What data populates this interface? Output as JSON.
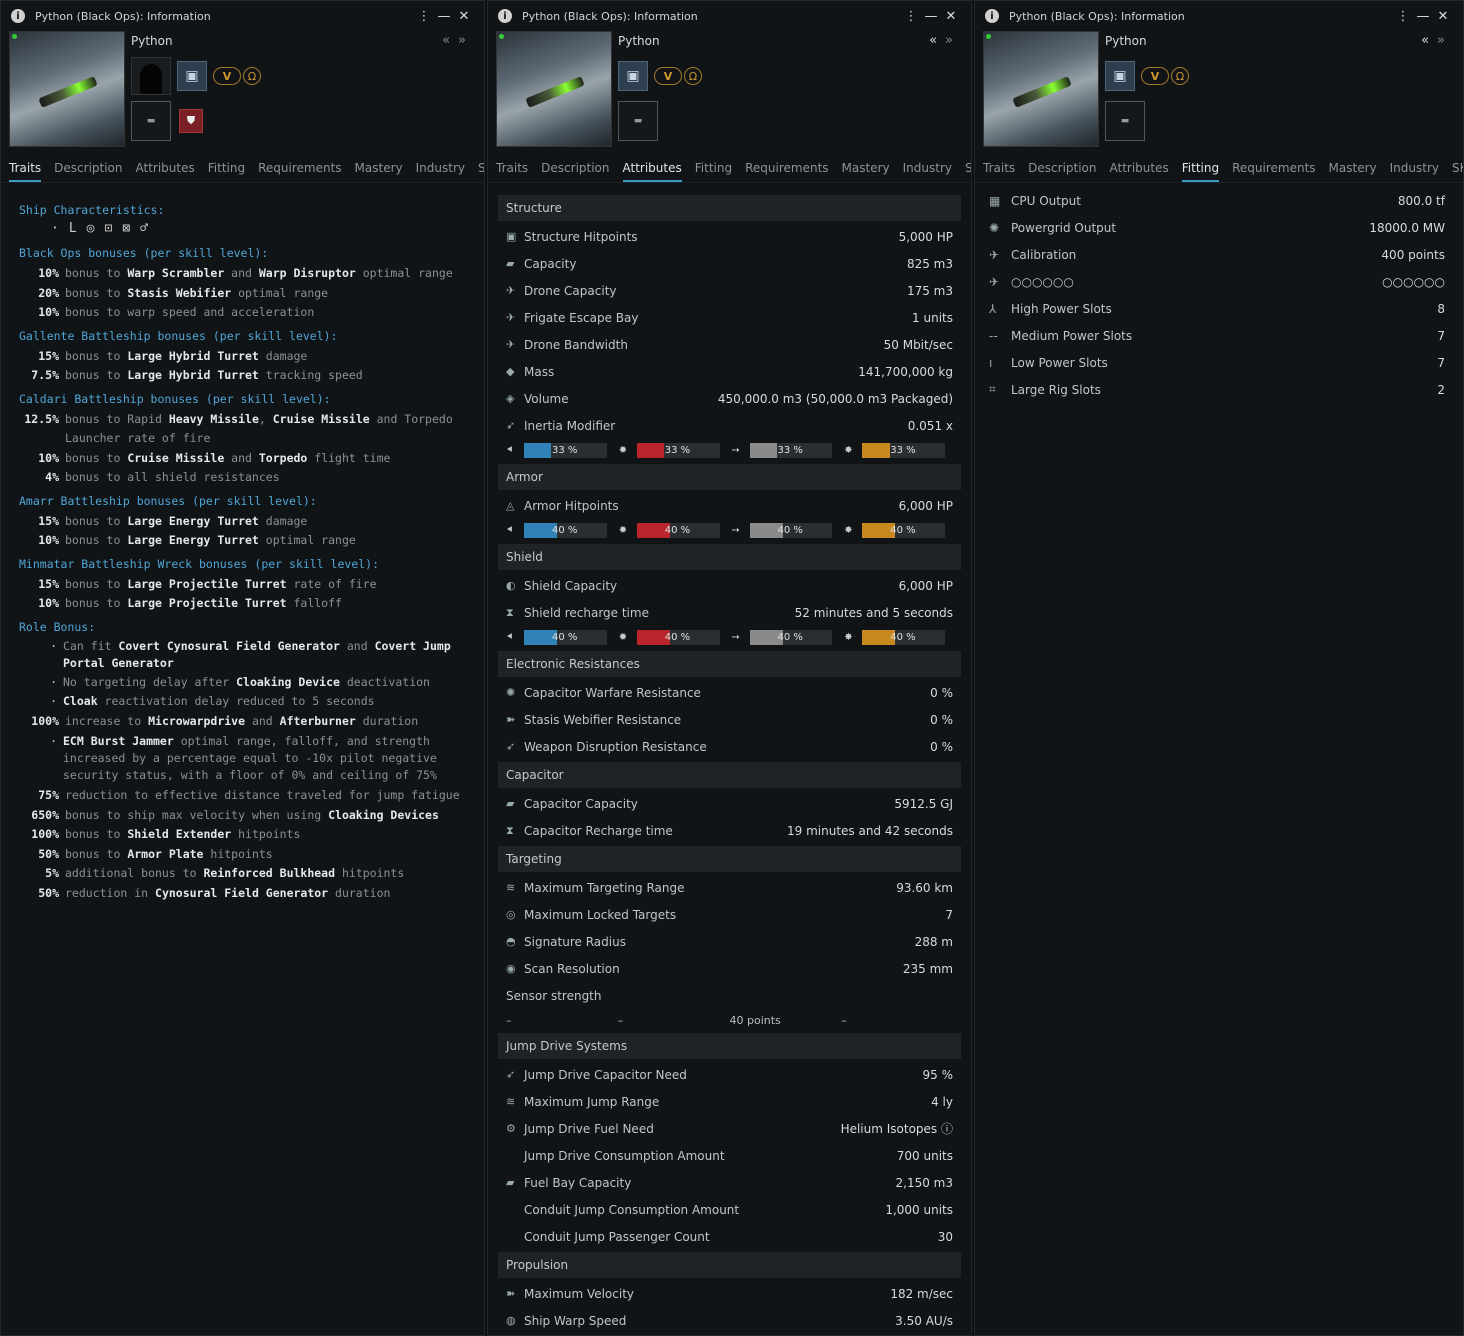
{
  "window_title": "Python (Black Ops): Information",
  "ship_name": "Python",
  "tabs": [
    "Traits",
    "Description",
    "Attributes",
    "Fitting",
    "Requirements",
    "Mastery",
    "Industry",
    "SKINs"
  ],
  "traits": {
    "ship_chars": "Ship Characteristics:",
    "black_ops": {
      "title": "Black Ops bonuses (per skill level):",
      "rows": [
        {
          "pct": "10%",
          "pre": "bonus to ",
          "b1": "Warp Scrambler",
          "m1": " and ",
          "b2": "Warp Disruptor",
          "post": " optimal range"
        },
        {
          "pct": "20%",
          "pre": "bonus to ",
          "b1": "Stasis Webifier",
          "m1": "",
          "b2": "",
          "post": " optimal range"
        },
        {
          "pct": "10%",
          "pre": "bonus to warp speed and acceleration",
          "b1": "",
          "m1": "",
          "b2": "",
          "post": ""
        }
      ]
    },
    "gallente": {
      "title": "Gallente Battleship bonuses (per skill level):",
      "rows": [
        {
          "pct": "15%",
          "pre": "bonus to ",
          "b1": "Large Hybrid Turret",
          "m1": "",
          "b2": "",
          "post": " damage"
        },
        {
          "pct": "7.5%",
          "pre": "bonus to ",
          "b1": "Large Hybrid Turret",
          "m1": "",
          "b2": "",
          "post": " tracking speed"
        }
      ]
    },
    "caldari": {
      "title": "Caldari Battleship bonuses (per skill level):",
      "rows": [
        {
          "pct": "12.5%",
          "pre": "bonus to Rapid ",
          "b1": "Heavy Missile",
          "m1": ", ",
          "b2": "Cruise Missile",
          "post": " and Torpedo Launcher rate of fire"
        },
        {
          "pct": "10%",
          "pre": "bonus to ",
          "b1": "Cruise Missile",
          "m1": " and ",
          "b2": "Torpedo",
          "post": " flight time"
        },
        {
          "pct": "4%",
          "pre": "bonus to all shield resistances",
          "b1": "",
          "m1": "",
          "b2": "",
          "post": ""
        }
      ]
    },
    "amarr": {
      "title": "Amarr Battleship bonuses (per skill level):",
      "rows": [
        {
          "pct": "15%",
          "pre": "bonus to ",
          "b1": "Large Energy Turret",
          "m1": "",
          "b2": "",
          "post": " damage"
        },
        {
          "pct": "10%",
          "pre": "bonus to ",
          "b1": "Large Energy Turret",
          "m1": "",
          "b2": "",
          "post": " optimal range"
        }
      ]
    },
    "minmatar": {
      "title": "Minmatar Battleship Wreck bonuses (per skill level):",
      "rows": [
        {
          "pct": "15%",
          "pre": "bonus to ",
          "b1": "Large Projectile Turret",
          "m1": "",
          "b2": "",
          "post": " rate of fire"
        },
        {
          "pct": "10%",
          "pre": "bonus to ",
          "b1": "Large Projectile Turret",
          "m1": "",
          "b2": "",
          "post": " falloff"
        }
      ]
    },
    "role": {
      "title": "Role Bonus:",
      "rows": [
        {
          "pct": "·",
          "pre": "Can fit ",
          "b1": "Covert Cynosural Field Generator",
          "m1": " and ",
          "b2": "Covert Jump Portal Generator",
          "post": ""
        },
        {
          "pct": "·",
          "pre": "No targeting delay after ",
          "b1": "Cloaking Device",
          "m1": "",
          "b2": "",
          "post": " deactivation"
        },
        {
          "pct": "·",
          "pre": "",
          "b1": "Cloak",
          "m1": "",
          "b2": "",
          "post": " reactivation delay reduced to 5 seconds"
        },
        {
          "pct": "100%",
          "pre": "increase to ",
          "b1": "Microwarpdrive",
          "m1": " and ",
          "b2": "Afterburner",
          "post": " duration"
        },
        {
          "pct": "·",
          "pre": "",
          "b1": "ECM Burst Jammer",
          "m1": "",
          "b2": "",
          "post": " optimal range, falloff, and strength increased by a percentage equal to -10x pilot negative security status, with a floor of 0% and ceiling of 75%"
        },
        {
          "pct": "75%",
          "pre": "reduction to effective distance traveled for jump fatigue",
          "b1": "",
          "m1": "",
          "b2": "",
          "post": ""
        },
        {
          "pct": "650%",
          "pre": "bonus to ship max velocity when using ",
          "b1": "Cloaking Devices",
          "m1": "",
          "b2": "",
          "post": ""
        },
        {
          "pct": "100%",
          "pre": "bonus to ",
          "b1": "Shield Extender",
          "m1": "",
          "b2": "",
          "post": " hitpoints"
        },
        {
          "pct": "50%",
          "pre": "bonus to ",
          "b1": "Armor Plate",
          "m1": "",
          "b2": "",
          "post": " hitpoints"
        },
        {
          "pct": "5%",
          "pre": "additional bonus to ",
          "b1": "Reinforced Bulkhead",
          "m1": "",
          "b2": "",
          "post": " hitpoints"
        },
        {
          "pct": "50%",
          "pre": "reduction in ",
          "b1": "Cynosural Field Generator",
          "m1": "",
          "b2": "",
          "post": " duration"
        }
      ]
    }
  },
  "attributes": [
    {
      "cat": "Structure",
      "rows": [
        [
          "▣",
          "Structure Hitpoints",
          "5,000 HP"
        ],
        [
          "▰",
          "Capacity",
          "825 m3"
        ],
        [
          "✈",
          "Drone Capacity",
          "175 m3"
        ],
        [
          "✈",
          "Frigate Escape Bay",
          "1 units"
        ],
        [
          "✈",
          "Drone Bandwidth",
          "50 Mbit/sec"
        ],
        [
          "◆",
          "Mass",
          "141,700,000 kg"
        ],
        [
          "◈",
          "Volume",
          "450,000.0 m3 (50,000.0 m3 Packaged)"
        ],
        [
          "➶",
          "Inertia Modifier",
          "0.051 x"
        ]
      ],
      "res": [
        "33 %",
        "33 %",
        "33 %",
        "33 %"
      ]
    },
    {
      "cat": "Armor",
      "rows": [
        [
          "◬",
          "Armor Hitpoints",
          "6,000 HP"
        ]
      ],
      "res": [
        "40 %",
        "40 %",
        "40 %",
        "40 %"
      ]
    },
    {
      "cat": "Shield",
      "rows": [
        [
          "◐",
          "Shield Capacity",
          "6,000 HP"
        ],
        [
          "⧗",
          "Shield recharge time",
          "52 minutes and 5 seconds"
        ]
      ],
      "res": [
        "40 %",
        "40 %",
        "40 %",
        "40 %"
      ]
    },
    {
      "cat": "Electronic Resistances",
      "rows": [
        [
          "✺",
          "Capacitor Warfare Resistance",
          "0 %"
        ],
        [
          "➽",
          "Stasis Webifier Resistance",
          "0 %"
        ],
        [
          "➶",
          "Weapon Disruption Resistance",
          "0 %"
        ]
      ]
    },
    {
      "cat": "Capacitor",
      "rows": [
        [
          "▰",
          "Capacitor Capacity",
          "5912.5 GJ"
        ],
        [
          "⧗",
          "Capacitor Recharge time",
          "19 minutes and 42 seconds"
        ]
      ]
    },
    {
      "cat": "Targeting",
      "rows": [
        [
          "≋",
          "Maximum Targeting Range",
          "93.60 km"
        ],
        [
          "◎",
          "Maximum Locked Targets",
          "7"
        ],
        [
          "◓",
          "Signature Radius",
          "288 m"
        ],
        [
          "◉",
          "Scan Resolution",
          "235 mm"
        ]
      ]
    },
    {
      "cat": "Jump Drive Systems",
      "rows": [
        [
          "➶",
          "Jump Drive Capacitor Need",
          "95 %"
        ],
        [
          "≋",
          "Maximum Jump Range",
          "4 ly"
        ],
        [
          "⚙",
          "Jump Drive Fuel Need",
          "Helium Isotopes ⓘ"
        ],
        [
          "",
          "Jump Drive Consumption Amount",
          "700 units"
        ],
        [
          "▰",
          "Fuel Bay Capacity",
          "2,150 m3"
        ],
        [
          "",
          "Conduit Jump Consumption Amount",
          "1,000 units"
        ],
        [
          "",
          "Conduit Jump Passenger Count",
          "30"
        ]
      ]
    },
    {
      "cat": "Propulsion",
      "rows": [
        [
          "➽",
          "Maximum Velocity",
          "182 m/sec"
        ],
        [
          "◍",
          "Ship Warp Speed",
          "3.50 AU/s"
        ]
      ]
    }
  ],
  "sensor": {
    "label": "Sensor strength",
    "vals": [
      "–",
      "–",
      "40 points",
      "–"
    ]
  },
  "res_colors": [
    "#2f83b8",
    "#b8262b",
    "#8a8a8a",
    "#c88a1e"
  ],
  "res_levels": [
    [
      33,
      33,
      33,
      33
    ],
    [
      40,
      40,
      40,
      40
    ],
    [
      40,
      40,
      40,
      40
    ]
  ],
  "fitting": [
    [
      "▦",
      "CPU Output",
      "800.0 tf"
    ],
    [
      "✺",
      "Powergrid Output",
      "18000.0 MW"
    ],
    [
      "✈",
      "Calibration",
      "400 points"
    ],
    [
      "✈",
      "○○○○○○",
      "○○○○○○"
    ],
    [
      "⅄",
      "High Power Slots",
      "8"
    ],
    [
      "--",
      "Medium Power Slots",
      "7"
    ],
    [
      "ı",
      "Low Power Slots",
      "7"
    ],
    [
      "⌗",
      "Large Rig Slots",
      "2"
    ]
  ]
}
